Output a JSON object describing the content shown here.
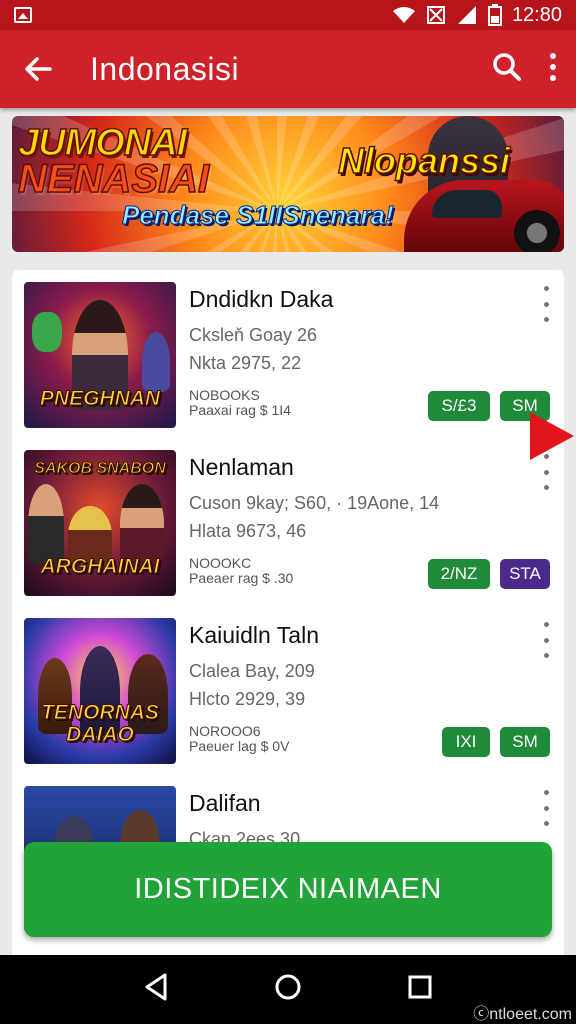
{
  "status_bar": {
    "time": "12:80",
    "icons": [
      "image-icon",
      "wifi-icon",
      "no-signal-icon",
      "cell-signal-icon",
      "battery-icon"
    ]
  },
  "app_bar": {
    "title": "Indonasisi",
    "icons": [
      "back-arrow-icon",
      "search-icon",
      "overflow-menu-icon"
    ]
  },
  "banner": {
    "line1": "JUMONAI",
    "line2": "NENASIAI",
    "line3": "Pendase S1IISnenara!",
    "line4": "Nlopanssi"
  },
  "games": [
    {
      "name": "Dndidkn Daka",
      "meta1": "Cksleň Goay 26",
      "meta2": "Nkta 2975, 22",
      "sub1": "NOBOOKS",
      "sub2": "Paaxai rag $ 1I4",
      "thumb_label": "PNEGHNAN",
      "pill1": "S/£3",
      "pill2": "SM",
      "pill1_color": "#1f8a3a",
      "pill2_color": "#1f8a3a"
    },
    {
      "name": "Nenlaman",
      "meta1": "Cuson 9kay; S60, · 19Aone, 14",
      "meta2": "Hlata 9673, 46",
      "sub1": "NOOOKC",
      "sub2": "Paeaer rag $ .30",
      "thumb_label": "ARGHAINAI",
      "thumb_top": "SAKOB SNABON",
      "pill1": "2/NZ",
      "pill2": "STA",
      "pill1_color": "#1f8a3a",
      "pill2_color": "#4b2a8c"
    },
    {
      "name": "Kaiuidln Taln",
      "meta1": "Clalea Bay, 209",
      "meta2": "Hlcto 2929, 39",
      "sub1": "NOROOO6",
      "sub2": "Paeuer lag $ 0V",
      "thumb_label": "TENORNAS DAIAO",
      "pill1": "IXI",
      "pill2": "SM",
      "pill1_color": "#1f8a3a",
      "pill2_color": "#1f8a3a"
    },
    {
      "name": "Dalifan",
      "meta1": "Ckan 2ees 30",
      "meta2": "",
      "sub1": "",
      "sub2": ""
    }
  ],
  "cta": {
    "label": "IDISTIDEIX NIAIMAEN"
  },
  "nav": {
    "icons": [
      "back-triangle-icon",
      "home-circle-icon",
      "recents-square-icon"
    ]
  },
  "watermark": "ⓒntloeet.com",
  "colors": {
    "status_bar": "#b7141c",
    "app_bar": "#cf2129",
    "cta": "#21a33a"
  }
}
